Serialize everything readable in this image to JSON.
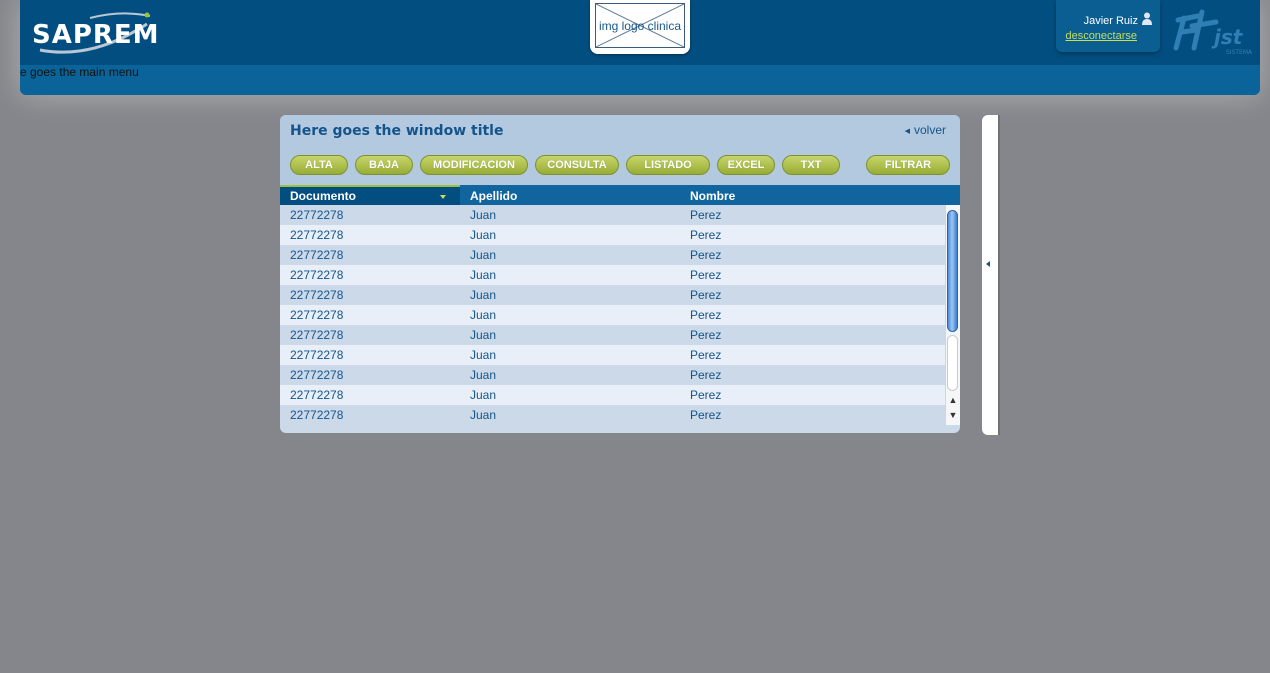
{
  "header": {
    "brand_name": "SAPREM",
    "clinic_logo_text": "img logo clinica",
    "user_name": "Javier Ruiz",
    "logout_label": "desconectarse",
    "main_menu_text": "e goes the main menu",
    "colors": {
      "top_bar": "#034e80",
      "menu_bar": "#0a6499",
      "link_accent": "#c6df5a"
    }
  },
  "window": {
    "title": "Here goes the window title",
    "back_label": "volver",
    "toolbar": {
      "alta": "ALTA",
      "baja": "BAJA",
      "modificacion": "MODIFICACION",
      "consulta": "CONSULTA",
      "listado": "LISTADO",
      "excel": "EXCEL",
      "txt": "TXT",
      "filtrar": "FILTRAR"
    },
    "grid": {
      "columns": [
        "Documento",
        "Apellido",
        "Nombre"
      ],
      "sorted_column": "Documento",
      "rows": [
        [
          "22772278",
          "Juan",
          "Perez"
        ],
        [
          "22772278",
          "Juan",
          "Perez"
        ],
        [
          "22772278",
          "Juan",
          "Perez"
        ],
        [
          "22772278",
          "Juan",
          "Perez"
        ],
        [
          "22772278",
          "Juan",
          "Perez"
        ],
        [
          "22772278",
          "Juan",
          "Perez"
        ],
        [
          "22772278",
          "Juan",
          "Perez"
        ],
        [
          "22772278",
          "Juan",
          "Perez"
        ],
        [
          "22772278",
          "Juan",
          "Perez"
        ],
        [
          "22772278",
          "Juan",
          "Perez"
        ],
        [
          "22772278",
          "Juan",
          "Perez"
        ]
      ]
    },
    "colors": {
      "button": "#b2c24e",
      "grid_header": "#10659e",
      "scroll_thumb": "#4a8ad8"
    }
  },
  "icons": {
    "user": "user-icon",
    "sort": "sort-down-icon",
    "back": "chevron-left-icon",
    "side_toggle": "chevron-left-icon",
    "scroll_up": "arrow-up-icon",
    "scroll_down": "arrow-down-icon"
  }
}
